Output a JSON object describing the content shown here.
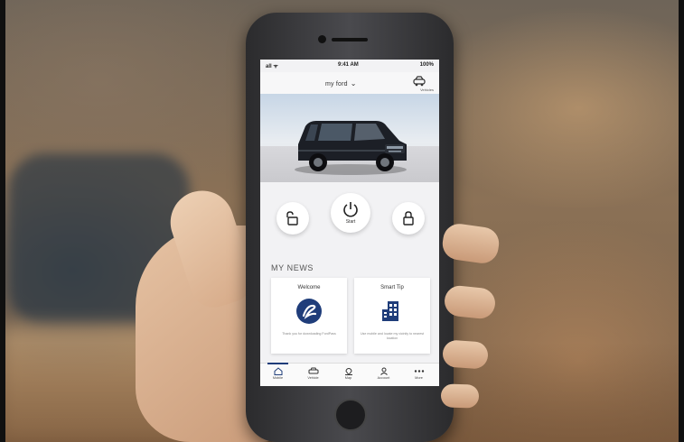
{
  "status_bar": {
    "signal": "all ᯤ",
    "time": "9:41 AM",
    "battery": "100%"
  },
  "header": {
    "vehicle_select": "my ford",
    "right_icon_label": "Vehicles",
    "right_icon": "car-list-icon"
  },
  "vehicle": {
    "image": "black-suv-illustration",
    "body_color": "#1c1f26"
  },
  "controls": {
    "unlock_icon": "unlock-icon",
    "start_label": "Start",
    "start_icon": "power-icon",
    "lock_icon": "lock-icon"
  },
  "news": {
    "section_title": "MY NEWS",
    "cards": [
      {
        "title": "Welcome",
        "icon": "welcome-logo-icon",
        "text": "Thank you for downloading FordPass"
      },
      {
        "title": "Smart Tip",
        "icon": "building-icon",
        "text": "Use mobile and locate my vicinity to nearest location"
      }
    ]
  },
  "tab_bar": {
    "items": [
      {
        "label": "Mobile",
        "icon": "home-icon",
        "active": true
      },
      {
        "label": "Vehicle",
        "icon": "car-icon",
        "active": false
      },
      {
        "label": "Map",
        "icon": "map-pin-icon",
        "active": false
      },
      {
        "label": "Account",
        "icon": "user-icon",
        "active": false
      },
      {
        "label": "More",
        "icon": "more-dots-icon",
        "active": false
      }
    ]
  },
  "colors": {
    "accent": "#1f3d7a",
    "screen_bg": "#f2f2f4",
    "phone_body": "#3a3a3d"
  }
}
